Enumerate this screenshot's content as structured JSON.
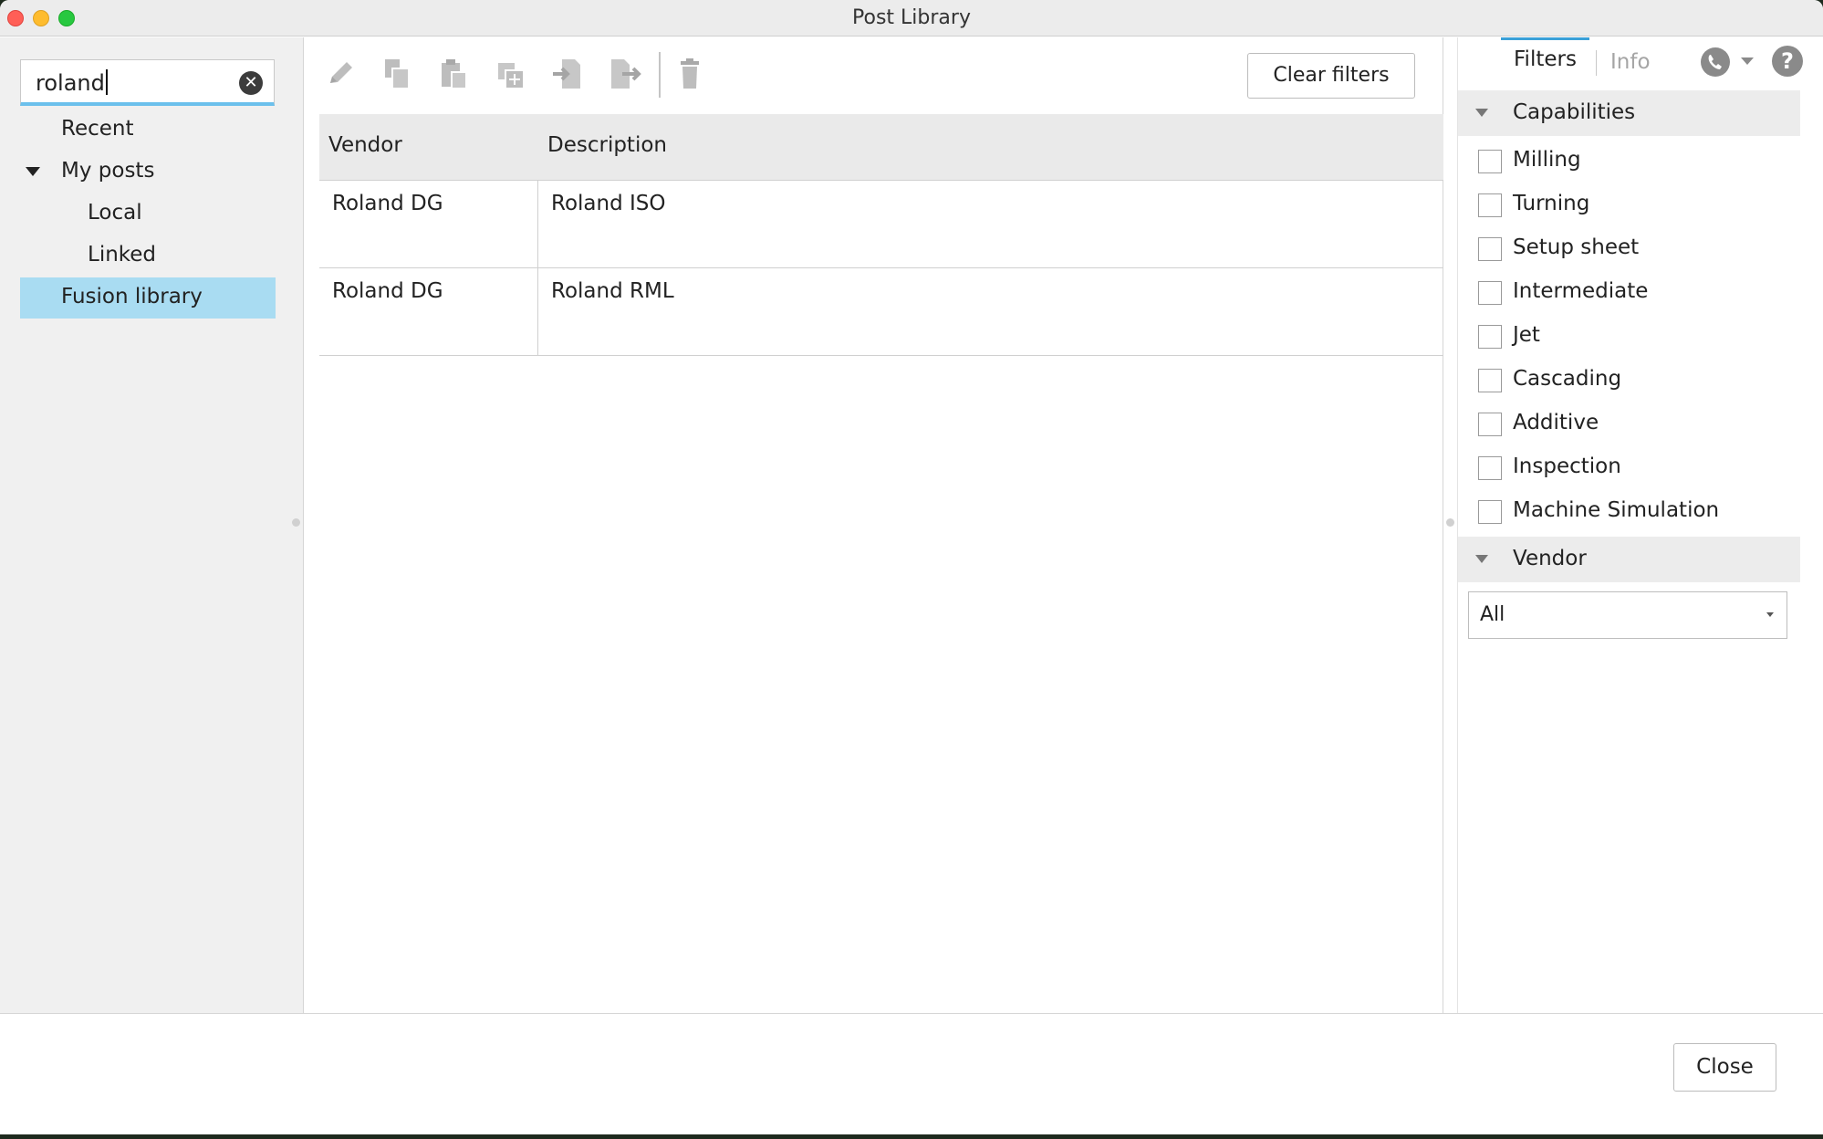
{
  "window": {
    "title": "Post Library"
  },
  "search": {
    "value": "roland",
    "clear_icon": "clear-circle-icon"
  },
  "nav": {
    "items": [
      {
        "label": "Recent"
      },
      {
        "label": "My posts",
        "expanded": true
      },
      {
        "label": "Local"
      },
      {
        "label": "Linked"
      },
      {
        "label": "Fusion library",
        "selected": true
      }
    ]
  },
  "toolbar": {
    "icons": [
      "edit-icon",
      "copy-icon",
      "paste-icon",
      "duplicate-icon",
      "import-icon",
      "export-icon",
      "delete-icon"
    ],
    "clear_filters_label": "Clear filters"
  },
  "table": {
    "columns": [
      "Vendor",
      "Description"
    ],
    "rows": [
      {
        "vendor": "Roland DG",
        "description": "Roland ISO"
      },
      {
        "vendor": "Roland DG",
        "description": "Roland RML"
      }
    ]
  },
  "filters_panel": {
    "tabs": [
      {
        "label": "Filters",
        "active": true
      },
      {
        "label": "Info",
        "active": false
      }
    ],
    "capabilities": {
      "title": "Capabilities",
      "options": [
        "Milling",
        "Turning",
        "Setup sheet",
        "Intermediate",
        "Jet",
        "Cascading",
        "Additive",
        "Inspection",
        "Machine Simulation"
      ]
    },
    "vendor": {
      "title": "Vendor",
      "selected": "All"
    },
    "help_glyph": "?"
  },
  "footer": {
    "close_label": "Close"
  },
  "colors": {
    "selection": "#a9dcf2",
    "accent": "#3aa0d8",
    "search_underline": "#6cc0ec"
  }
}
